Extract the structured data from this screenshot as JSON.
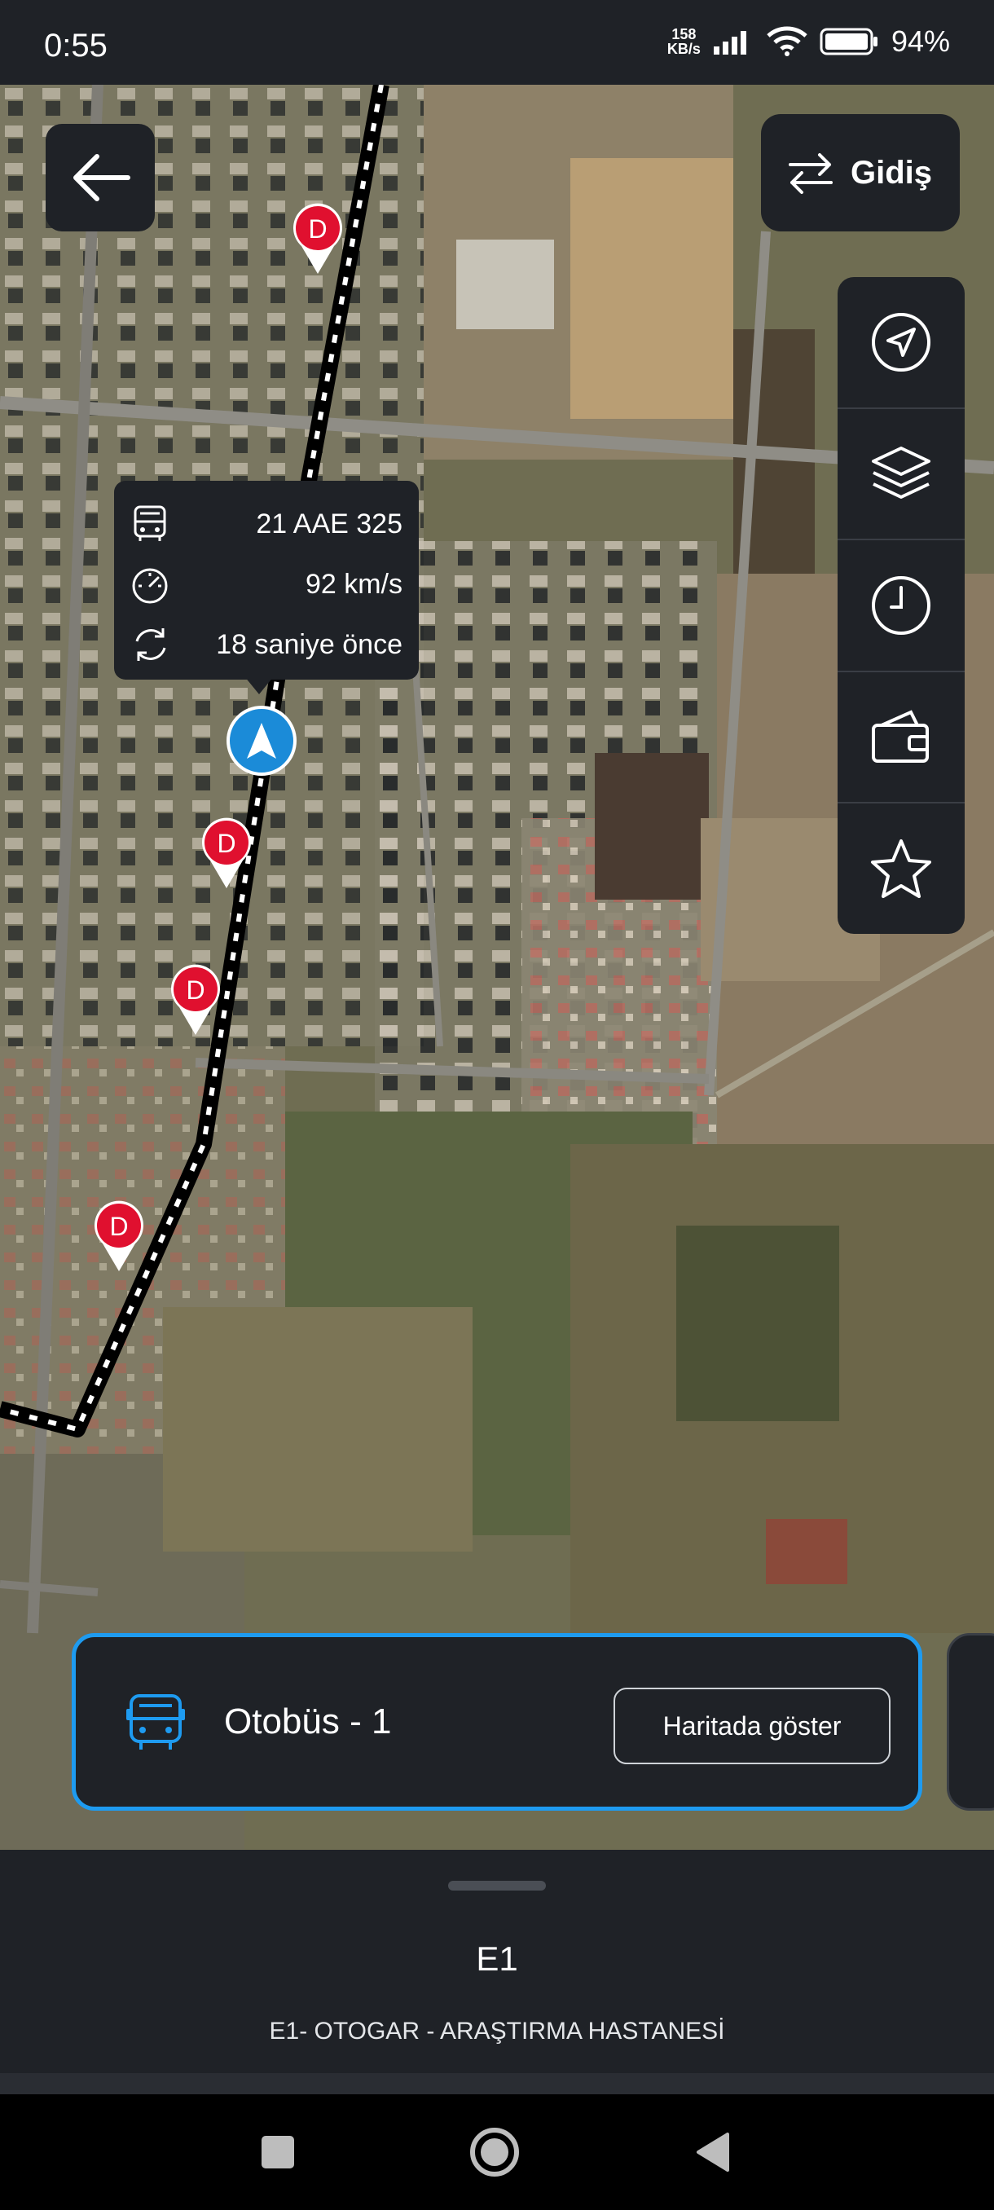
{
  "status_bar": {
    "time": "0:55",
    "net_speed_value": "158",
    "net_speed_unit": "KB/s",
    "battery": "94%"
  },
  "header": {
    "back_icon": "arrow-left-icon",
    "direction_label": "Gidiş",
    "direction_icon": "swap-arrows-icon"
  },
  "tools": [
    {
      "name": "tool-locate",
      "icon": "navigation-arrow-icon"
    },
    {
      "name": "tool-layers",
      "icon": "layers-icon"
    },
    {
      "name": "tool-schedule",
      "icon": "clock-icon"
    },
    {
      "name": "tool-wallet",
      "icon": "wallet-icon"
    },
    {
      "name": "tool-favorite",
      "icon": "star-icon"
    }
  ],
  "vehicle_popup": {
    "plate": "21 AAE 325",
    "speed": "92 km/s",
    "updated": "18 saniye önce"
  },
  "stop_marker_letter": "D",
  "vehicle_card": {
    "title": "Otobüs - 1",
    "button": "Haritada göster"
  },
  "route": {
    "code": "E1",
    "name": "E1- OTOGAR - ARAŞTIRMA HASTANESİ"
  },
  "colors": {
    "accent": "#1e9bf0",
    "panel": "#1f2227",
    "stop_red": "#e0102f",
    "bus_marker": "#1b8bd8"
  }
}
